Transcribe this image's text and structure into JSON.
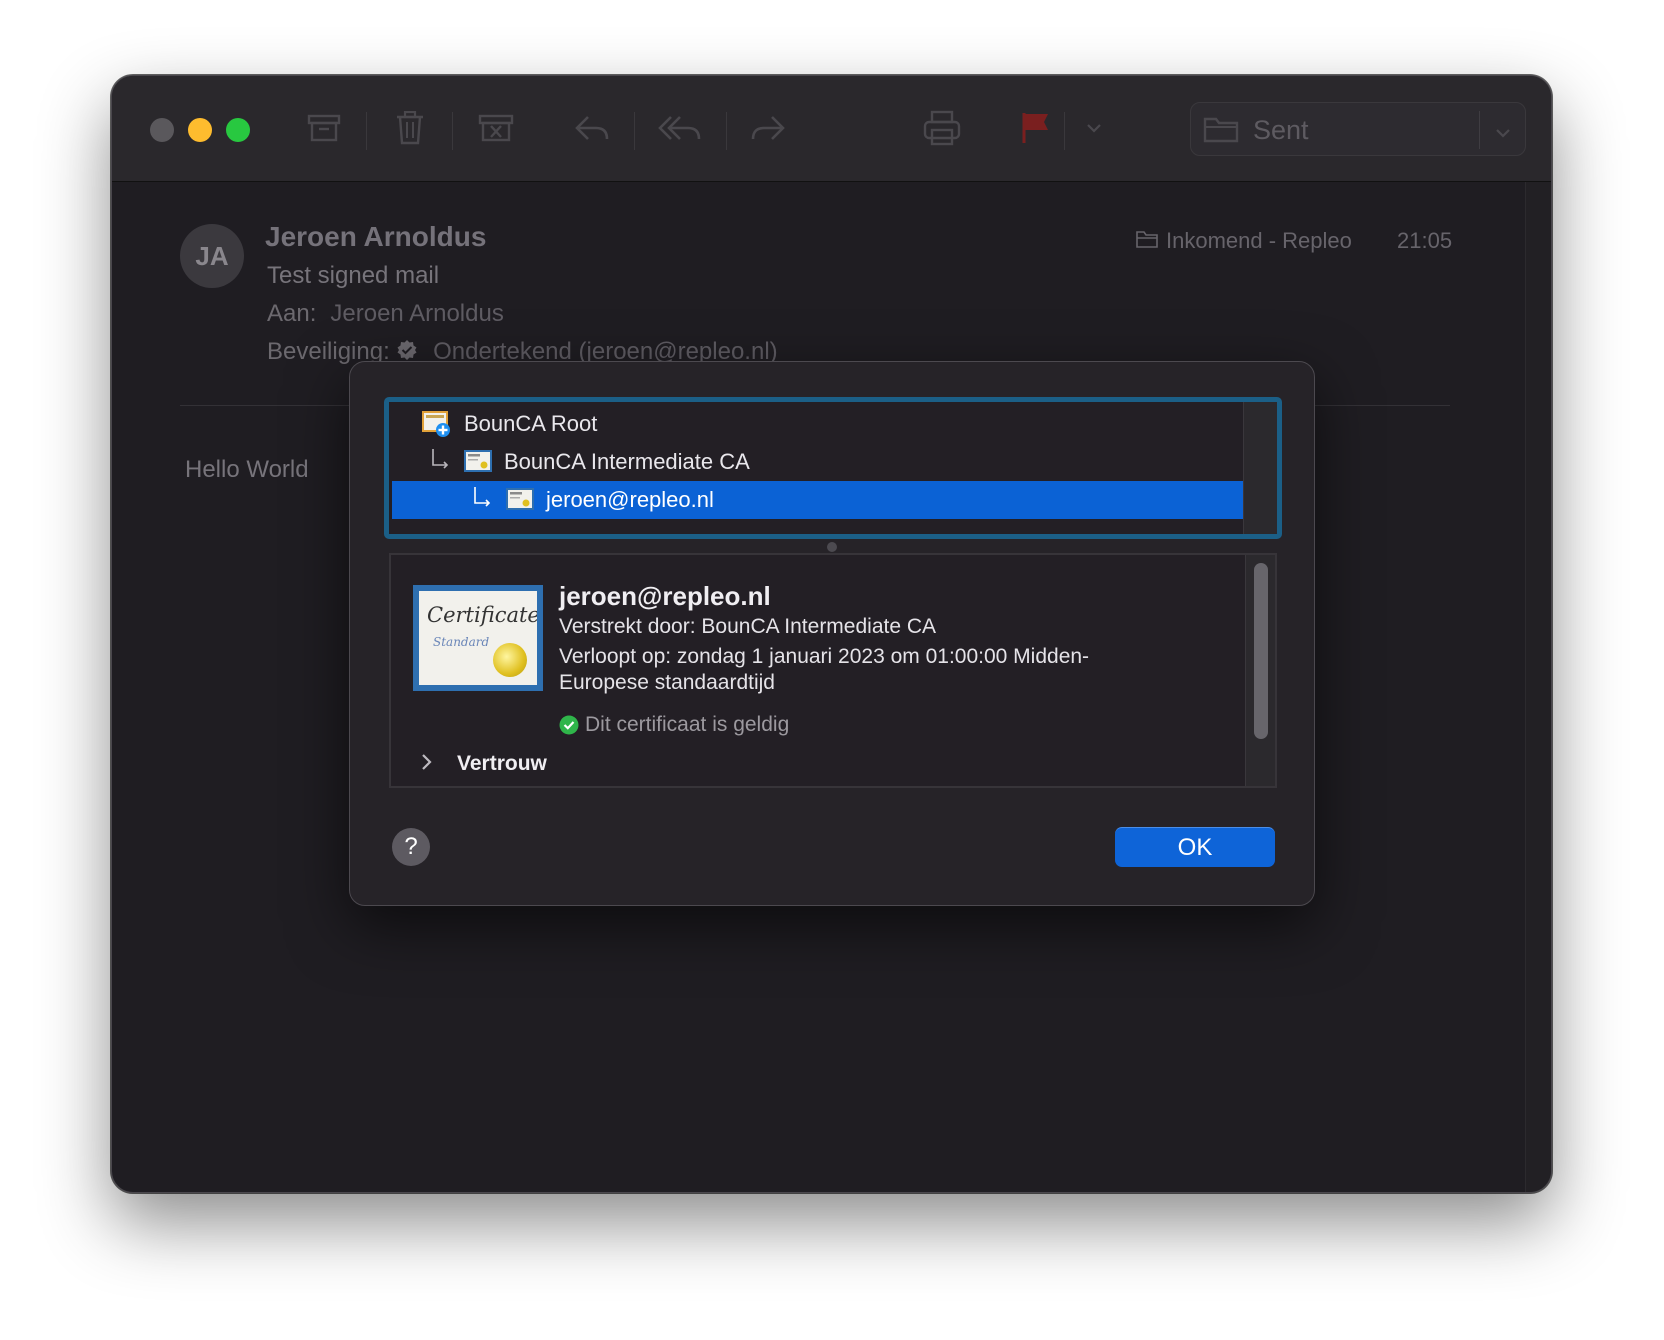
{
  "toolbar": {
    "mailbox_label": "Sent"
  },
  "message": {
    "avatar_initials": "JA",
    "sender": "Jeroen Arnoldus",
    "subject": "Test signed mail",
    "to_label": "Aan:",
    "to_value": "Jeroen Arnoldus",
    "security_label": "Beveiliging:",
    "security_value": "Ondertekend (jeroen@repleo.nl)",
    "mailbox": "Inkomend - Repleo",
    "time": "21:05",
    "body": "Hello World"
  },
  "dialog": {
    "chain": [
      {
        "label": "BounCA Root"
      },
      {
        "label": "BounCA Intermediate CA"
      },
      {
        "label": "jeroen@repleo.nl"
      }
    ],
    "cert": {
      "name": "jeroen@repleo.nl",
      "issued_by": "Verstrekt door: BounCA Intermediate CA",
      "expires_line1": "Verloopt op: zondag 1 januari 2023 om 01:00:00 Midden-",
      "expires_line2": "Europese standaardtijd",
      "valid": "Dit certificaat is geldig",
      "art_title": "Certificate",
      "art_sub": "Standard"
    },
    "trust_label": "Vertrouw",
    "help_label": "?",
    "ok_label": "OK"
  },
  "colors": {
    "accent": "#0b62d5",
    "flag": "#7a1f1f",
    "valid": "#2fb54a"
  }
}
